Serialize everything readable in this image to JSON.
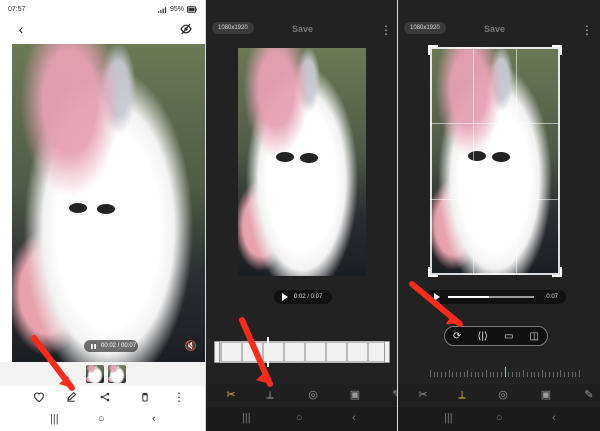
{
  "panel1": {
    "status": {
      "time": "07:57",
      "battery": "95%"
    },
    "video": {
      "time_text": "00:02 / 00:07"
    },
    "bottom_actions": [
      "favorite-icon",
      "edit-icon",
      "share-icon",
      "delete-icon",
      "more-icon"
    ],
    "nav": [
      "recent-apps-icon",
      "home-icon",
      "back-icon"
    ]
  },
  "panel2": {
    "badge": "1080x1920",
    "save_label": "Save",
    "video_time_text": "0:02 / 0:07",
    "tools": [
      "trim-icon",
      "adjust-icon",
      "filters-icon",
      "stickers-icon",
      "draw-icon"
    ],
    "nav": [
      "recent-apps-icon",
      "home-icon",
      "back-icon"
    ]
  },
  "panel3": {
    "badge": "1080x1920",
    "save_label": "Save",
    "video_time_text": "0:07",
    "transform_tools": [
      "rotate-icon",
      "flip-icon",
      "aspect-ratio-icon",
      "mirror-icon"
    ],
    "tools": [
      "trim-icon",
      "adjust-icon",
      "filters-icon",
      "stickers-icon",
      "draw-icon"
    ],
    "nav": [
      "recent-apps-icon",
      "home-icon",
      "back-icon"
    ]
  },
  "colors": {
    "accent": "#e6b432",
    "dark_bg": "#222222",
    "arrow_red": "#ff2a1a"
  }
}
